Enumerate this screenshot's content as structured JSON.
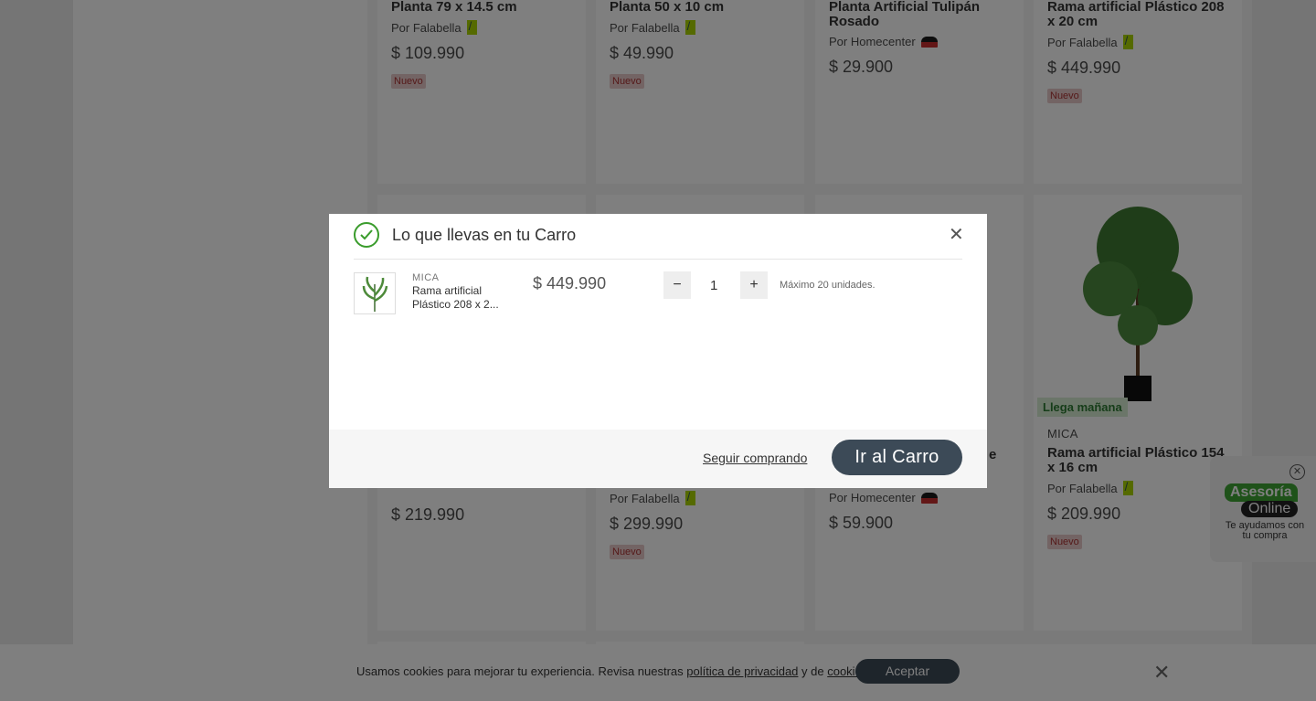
{
  "products": [
    {
      "title": "Planta 79 x 14.5 cm",
      "seller": "Por Falabella",
      "seller_type": "falabella",
      "price": "$ 109.990",
      "badge": "Nuevo"
    },
    {
      "title": "Planta 50 x 10 cm",
      "seller": "Por Falabella",
      "seller_type": "falabella",
      "price": "$ 49.990",
      "badge": "Nuevo"
    },
    {
      "title": "Planta Artificial Tulipán Rosado",
      "seller": "Por Homecenter",
      "seller_type": "homecenter",
      "price": "$ 29.900",
      "badge": ""
    },
    {
      "title": "Rama artificial Plástico 208 x 20 cm",
      "seller": "Por Falabella",
      "seller_type": "falabella",
      "price": "$ 449.990",
      "badge": "Nuevo"
    },
    {
      "price": "$ 219.990"
    },
    {
      "seller": "Por Falabella",
      "price": "$ 299.990",
      "badge": "Nuevo"
    },
    {
      "title_tail": "e",
      "seller": "Por Homecenter",
      "price": "$ 59.900"
    },
    {
      "delivery": "Llega mañana",
      "brand": "MICA",
      "title": "Rama artificial Plástico 154 x 16 cm",
      "seller": "Por Falabella",
      "price": "$ 209.990",
      "badge": "Nuevo"
    }
  ],
  "asesoria": {
    "line1": "Asesoría",
    "line2": "Online",
    "subtitle": "Te ayudamos con tu compra",
    "close": "✕"
  },
  "cookie": {
    "text_1": "Usamos cookies para mejorar tu experiencia. Revisa nuestras ",
    "privacy_link": "política de privacidad",
    "text_2": " y de ",
    "cookies_link": "cookies",
    "text_3": ".",
    "accept": "Aceptar",
    "close": "✕"
  },
  "modal": {
    "title": "Lo que llevas en tu Carro",
    "close": "✕",
    "item": {
      "brand": "MICA",
      "name": "Rama artificial Plástico 208 x 2...",
      "price": "$ 449.990",
      "quantity": "1",
      "minus": "−",
      "plus": "+",
      "max_units": "Máximo 20 unidades."
    },
    "continue_label": "Seguir comprando",
    "go_cart_label": "Ir al Carro"
  },
  "colors": {
    "primary_button": "#3c4a57",
    "success_green": "#3a9c2c",
    "badge_bg": "#e7c9c9",
    "delivery_green": "#2c7a32"
  }
}
